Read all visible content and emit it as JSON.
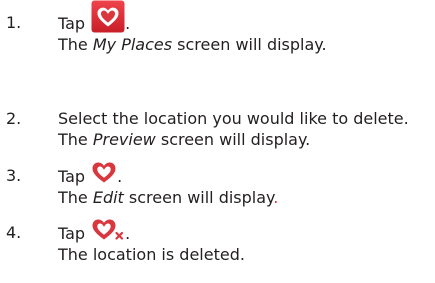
{
  "steps": [
    {
      "number": "1.",
      "tap": "Tap",
      "icon": "heart-in-red-square-icon",
      "after_icon": ".",
      "result_italic": "My Places",
      "result_rest": " screen will display.",
      "result_prefix": "The "
    },
    {
      "number": "2.",
      "line1": "Select the location you would like to delete.",
      "result_prefix": "The ",
      "result_italic": "Preview",
      "result_rest": " screen will display."
    },
    {
      "number": "3.",
      "tap": "Tap",
      "icon": "red-heart-outline-icon",
      "after_icon": ".",
      "result_prefix": "The ",
      "result_italic": "Edit",
      "result_rest": " screen will display",
      "result_end": "."
    },
    {
      "number": "4.",
      "tap": "Tap",
      "icon": "red-heart-remove-icon",
      "after_icon": ".",
      "result": "The location is deleted."
    }
  ],
  "colors": {
    "text": "#231f20",
    "icon_red": "#d9363e",
    "icon_box": "#e0242f"
  }
}
